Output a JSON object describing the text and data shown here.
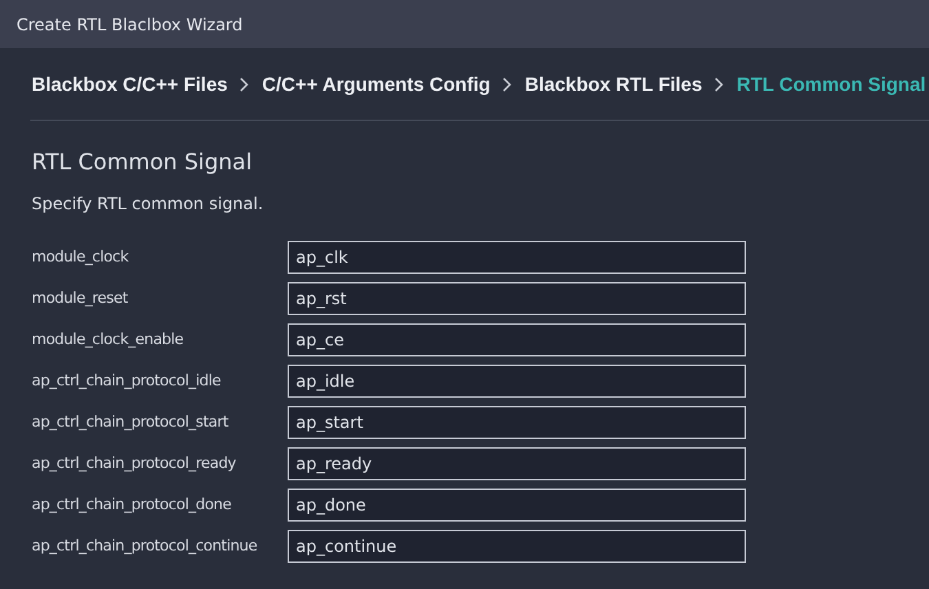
{
  "window": {
    "title": "Create RTL Blaclbox Wizard"
  },
  "breadcrumb": [
    {
      "label": "Blackbox C/C++ Files",
      "selected": false
    },
    {
      "label": "C/C++ Arguments Config",
      "selected": false
    },
    {
      "label": "Blackbox RTL Files",
      "selected": false
    },
    {
      "label": "RTL Common Signal",
      "selected": true
    }
  ],
  "section": {
    "title": "RTL Common Signal",
    "description": "Specify RTL common signal."
  },
  "fields": [
    {
      "label": "module_clock",
      "value": "ap_clk"
    },
    {
      "label": "module_reset",
      "value": "ap_rst"
    },
    {
      "label": "module_clock_enable",
      "value": "ap_ce"
    },
    {
      "label": "ap_ctrl_chain_protocol_idle",
      "value": "ap_idle"
    },
    {
      "label": "ap_ctrl_chain_protocol_start",
      "value": "ap_start"
    },
    {
      "label": "ap_ctrl_chain_protocol_ready",
      "value": "ap_ready"
    },
    {
      "label": "ap_ctrl_chain_protocol_done",
      "value": "ap_done"
    },
    {
      "label": "ap_ctrl_chain_protocol_continue",
      "value": "ap_continue"
    }
  ]
}
